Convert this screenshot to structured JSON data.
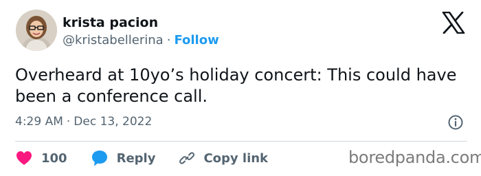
{
  "user": {
    "display_name": "krista pacion",
    "handle": "@kristabellerina",
    "separator": "·",
    "follow_label": "Follow"
  },
  "tweet": {
    "text": "Overheard at 10yo’s holiday concert: This could have been a conference call.",
    "time": "4:29 AM",
    "separator": "·",
    "date": "Dec 13, 2022"
  },
  "actions": {
    "likes_count": "100",
    "reply_label": "Reply",
    "copy_link_label": "Copy link"
  },
  "watermark": "boredpanda.com",
  "icons": {
    "brand": "x-logo-icon",
    "info": "info-icon",
    "like": "heart-icon",
    "reply": "speech-bubble-icon",
    "copy": "link-icon"
  },
  "colors": {
    "text": "#0f1419",
    "muted": "#536471",
    "follow": "#1d9bf0",
    "heart": "#f91880",
    "reply": "#1d9bf0",
    "divider": "#cfd9de"
  }
}
